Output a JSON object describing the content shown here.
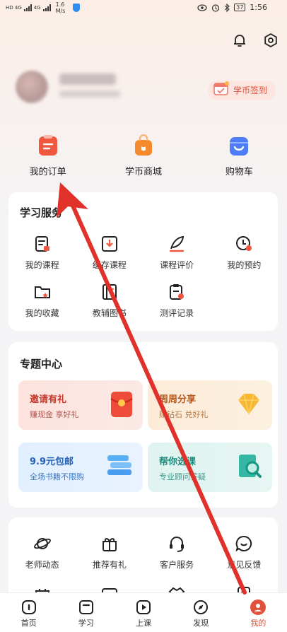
{
  "status_bar": {
    "network_1": "HD 4G",
    "network_2": "4G",
    "speed": "1.6",
    "speed_unit": "M/s",
    "battery": "37",
    "time": "1:56"
  },
  "header": {
    "bell_icon": "bell-icon",
    "settings_icon": "gear-icon"
  },
  "profile": {
    "checkin_label": "学币签到"
  },
  "quick_actions": [
    {
      "label": "我的订单",
      "icon": "order-icon",
      "color": "#f0573f"
    },
    {
      "label": "学币商城",
      "icon": "shop-bag-icon",
      "color": "#f58a2c"
    },
    {
      "label": "购物车",
      "icon": "cart-icon",
      "color": "#4f7df7"
    }
  ],
  "learning_services": {
    "title": "学习服务",
    "items": [
      {
        "label": "我的课程",
        "icon": "course-icon"
      },
      {
        "label": "缓存课程",
        "icon": "download-icon"
      },
      {
        "label": "课程评价",
        "icon": "quill-icon"
      },
      {
        "label": "我的预约",
        "icon": "clock-icon"
      },
      {
        "label": "我的收藏",
        "icon": "folder-star-icon"
      },
      {
        "label": "教辅图书",
        "icon": "book-icon"
      },
      {
        "label": "测评记录",
        "icon": "clipboard-icon"
      }
    ]
  },
  "topic_center": {
    "title": "专题中心",
    "promos": [
      {
        "title": "邀请有礼",
        "subtitle": "赚现金 享好礼",
        "title_color": "#c2392b",
        "subtitle_color": "#b0584c",
        "icon": "red-envelope-icon"
      },
      {
        "title": "周周分享",
        "subtitle": "赚钻石 兑好礼",
        "title_color": "#b4591d",
        "subtitle_color": "#b57a46",
        "icon": "diamond-icon"
      },
      {
        "title": "9.9元包邮",
        "subtitle": "全场书籍不限购",
        "title_color": "#2463b8",
        "subtitle_color": "#3f78c2",
        "icon": "books-icon"
      },
      {
        "title": "帮你选课",
        "subtitle": "专业顾问答疑",
        "title_color": "#1c8a7c",
        "subtitle_color": "#3a9a8c",
        "icon": "search-book-icon"
      }
    ]
  },
  "more_services": {
    "items": [
      {
        "label": "老师动态",
        "icon": "planet-icon"
      },
      {
        "label": "推荐有礼",
        "icon": "gift-icon"
      },
      {
        "label": "客户服务",
        "icon": "headset-icon"
      },
      {
        "label": "意见反馈",
        "icon": "feedback-icon"
      }
    ]
  },
  "tab_bar": {
    "tabs": [
      {
        "label": "首页",
        "icon": "home-icon"
      },
      {
        "label": "学习",
        "icon": "study-icon"
      },
      {
        "label": "上课",
        "icon": "play-icon"
      },
      {
        "label": "发现",
        "icon": "compass-icon"
      },
      {
        "label": "我的",
        "icon": "me-icon"
      }
    ],
    "active_color": "#e2513b"
  },
  "annotation": {
    "arrow_color": "#e0312b"
  }
}
